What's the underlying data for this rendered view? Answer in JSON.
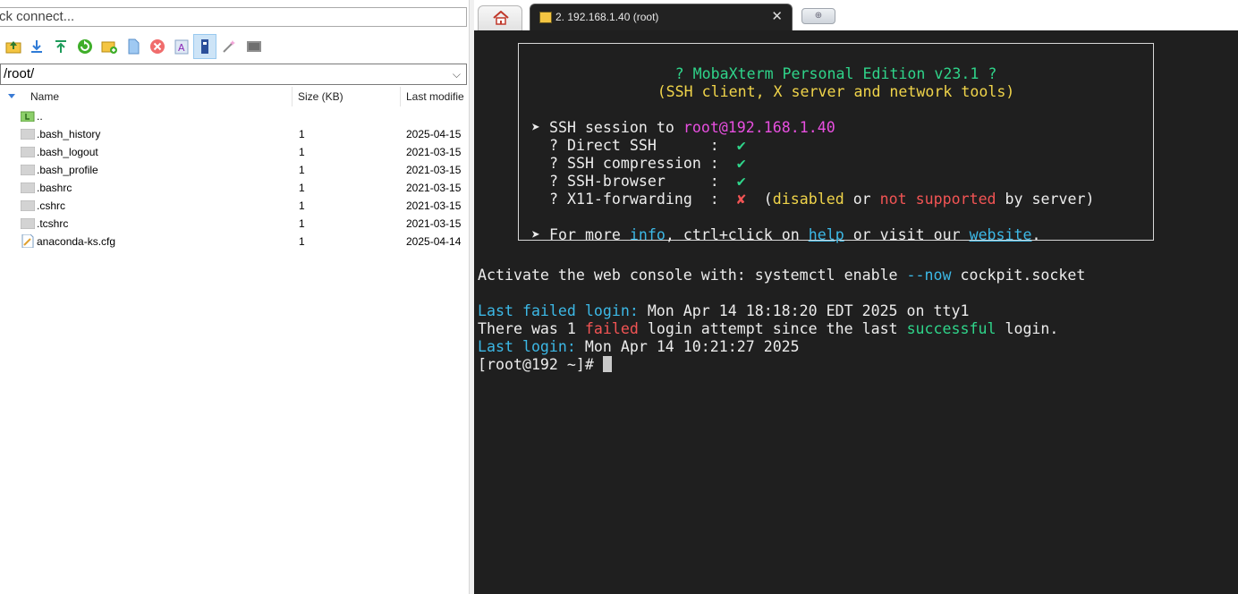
{
  "left_pane": {
    "quick_connect_placeholder": "ck connect...",
    "path": "/root/",
    "columns": {
      "name": "Name",
      "size": "Size (KB)",
      "modified": "Last modifie"
    },
    "files": [
      {
        "name": "..",
        "size": "",
        "modified": "",
        "icon": "parent-folder-icon"
      },
      {
        "name": ".bash_history",
        "size": "1",
        "modified": "2025-04-15",
        "icon": "file-icon"
      },
      {
        "name": ".bash_logout",
        "size": "1",
        "modified": "2021-03-15",
        "icon": "file-icon"
      },
      {
        "name": ".bash_profile",
        "size": "1",
        "modified": "2021-03-15",
        "icon": "file-icon"
      },
      {
        "name": ".bashrc",
        "size": "1",
        "modified": "2021-03-15",
        "icon": "file-icon"
      },
      {
        "name": ".cshrc",
        "size": "1",
        "modified": "2021-03-15",
        "icon": "file-icon"
      },
      {
        "name": ".tcshrc",
        "size": "1",
        "modified": "2021-03-15",
        "icon": "file-icon"
      },
      {
        "name": "anaconda-ks.cfg",
        "size": "1",
        "modified": "2025-04-14",
        "icon": "config-file-icon"
      }
    ]
  },
  "tabs": {
    "session_tab_label": "2. 192.168.1.40 (root)",
    "close_glyph": "✕",
    "new_tab_glyph": "⊕"
  },
  "terminal": {
    "banner_title": "? MobaXterm Personal Edition v23.1 ?",
    "banner_subtitle": "(SSH client, X server and network tools)",
    "ssh_session_prefix": "➤ SSH session to ",
    "ssh_target": "root@192.168.1.40",
    "direct_ssh": "  ? Direct SSH      :  ",
    "ssh_compression": "  ? SSH compression :  ",
    "ssh_browser": "  ? SSH-browser     :  ",
    "x11_forwarding": "  ? X11-forwarding  :  ",
    "check": "✔",
    "cross": "✘",
    "x11_open": "  (",
    "x11_disabled": "disabled",
    "x11_or": " or ",
    "x11_not_supported": "not supported",
    "x11_by_server": " by server)",
    "more_prefix": "➤ For more ",
    "more_info": "info",
    "more_mid": ", ctrl+click on ",
    "more_help": "help",
    "more_visit": " or visit our ",
    "more_website": "website",
    "more_end": ".",
    "activate_prefix": "Activate the web console with: systemctl enable ",
    "activate_flag": "--now",
    "activate_suffix": " cockpit.socket",
    "last_failed_label": "Last failed login:",
    "last_failed_value": " Mon Apr 14 18:18:20 EDT 2025 on tty1",
    "there_was": "There was 1 ",
    "failed_word": "failed",
    "login_attempt": " login attempt since the last ",
    "successful_word": "successful",
    "login_end": " login.",
    "last_login_label": "Last login:",
    "last_login_value": " Mon Apr 14 10:21:27 2025",
    "prompt": "[root@192 ~]# "
  },
  "colors": {
    "terminal_bg": "#1f1f1f",
    "accent_green": "#2fd48a",
    "accent_cyan": "#3cb8e6",
    "accent_red": "#f25454",
    "accent_yellow": "#f0d44a",
    "accent_magenta": "#e84fe0"
  }
}
